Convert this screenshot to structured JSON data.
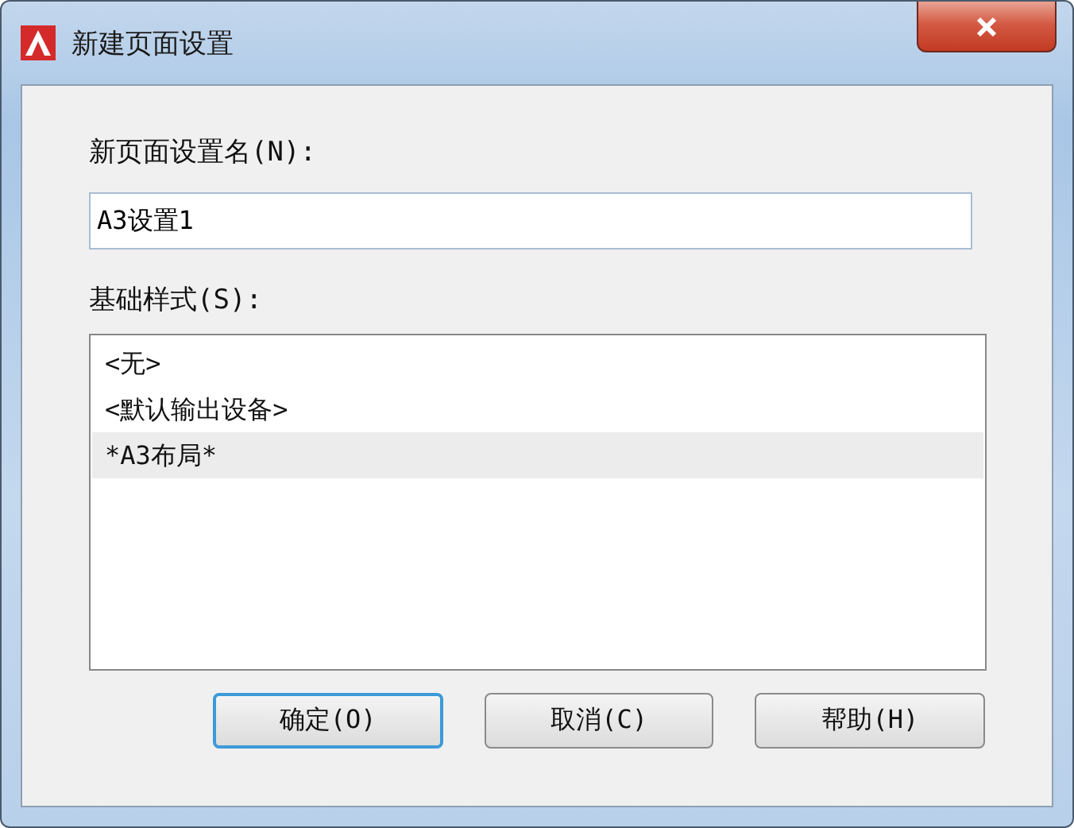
{
  "window": {
    "title": "新建页面设置"
  },
  "name_field": {
    "label": "新页面设置名(N):",
    "value": "A3设置1"
  },
  "base_style": {
    "label": "基础样式(S):",
    "items": [
      {
        "text": "<无>",
        "selected": false
      },
      {
        "text": "<默认输出设备>",
        "selected": false
      },
      {
        "text": "*A3布局*",
        "selected": true
      }
    ]
  },
  "buttons": [
    {
      "label": "确定(O)",
      "default": true
    },
    {
      "label": "取消(C)",
      "default": false
    },
    {
      "label": "帮助(H)",
      "default": false
    }
  ]
}
